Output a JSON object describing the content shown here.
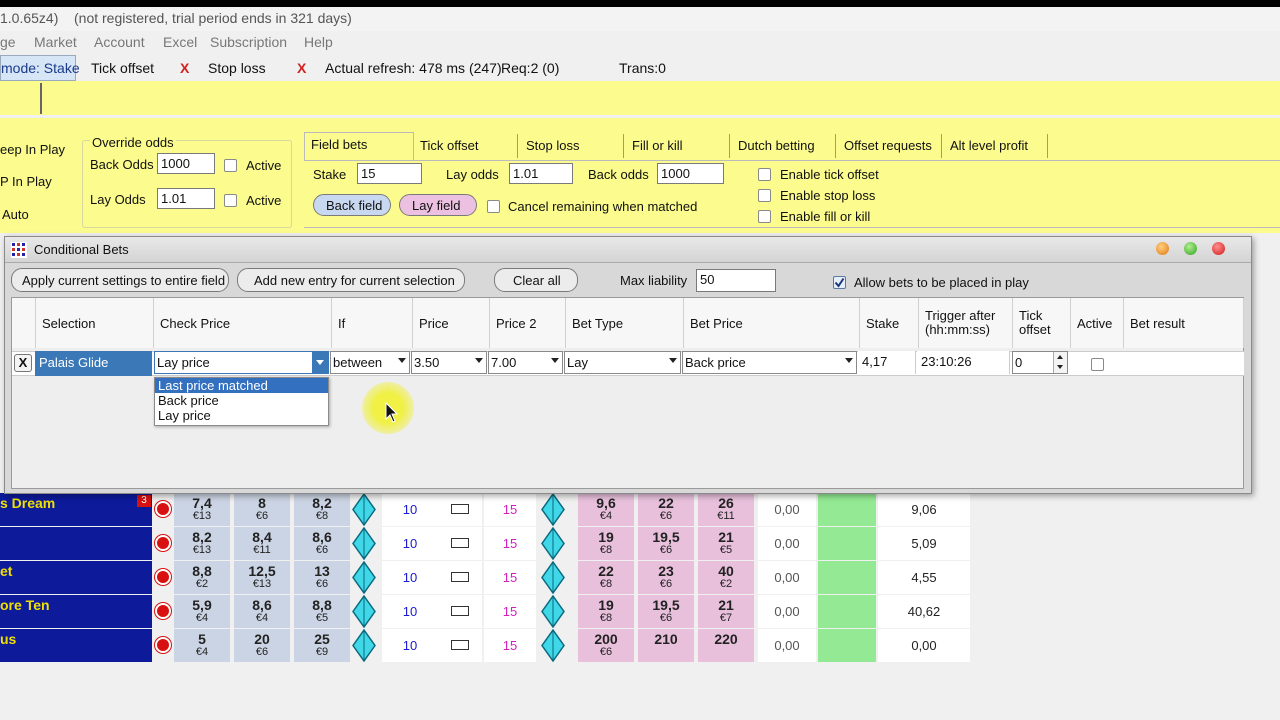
{
  "title_bar": {
    "version": "1.0.65z4)",
    "registration": "(not registered, trial period ends in 321 days)"
  },
  "menu": [
    "ge",
    "Market",
    "Account",
    "Excel",
    "Subscription",
    "Help"
  ],
  "status_bar": {
    "mode": "mode: Stake",
    "tick_offset": "Tick offset",
    "x1": "X",
    "stop_loss": "Stop loss",
    "x2": "X",
    "refresh": "Actual refresh: 478 ms (247)",
    "req": "Req:2 (0)",
    "trans": "Trans:0"
  },
  "left_options": [
    "eep In Play",
    "P In Play",
    "Auto"
  ],
  "override_odds": {
    "title": "Override odds",
    "back_label": "Back Odds",
    "back_value": "1000",
    "lay_label": "Lay Odds",
    "lay_value": "1.01",
    "active_label": "Active"
  },
  "tabs": [
    "Field bets",
    "Tick offset",
    "Stop loss",
    "Fill or kill",
    "Dutch betting",
    "Offset requests",
    "Alt level profit"
  ],
  "field_bets": {
    "stake_label": "Stake",
    "stake_value": "15",
    "lay_odds_label": "Lay odds",
    "lay_odds_value": "1.01",
    "back_odds_label": "Back odds",
    "back_odds_value": "1000",
    "back_field_btn": "Back field",
    "lay_field_btn": "Lay field",
    "cancel_remaining": "Cancel remaining when matched",
    "enable_tick_offset": "Enable tick offset",
    "enable_stop_loss": "Enable stop loss",
    "enable_fill_or_kill": "Enable fill or kill"
  },
  "dialog": {
    "title": "Conditional Bets",
    "apply_btn": "Apply current settings to entire field",
    "add_btn": "Add new entry for current selection",
    "clear_btn": "Clear all",
    "max_liability_label": "Max liability",
    "max_liability_value": "50",
    "allow_inplay_label": "Allow bets to be placed in play",
    "columns": [
      "Selection",
      "Check Price",
      "If",
      "Price",
      "Price 2",
      "Bet Type",
      "Bet Price",
      "Stake",
      "Trigger after (hh:mm:ss)",
      "Tick offset",
      "Active",
      "Bet result"
    ],
    "row": {
      "delete": "X",
      "selection": "Palais Glide",
      "check_price": "Lay price",
      "if": "between",
      "price": "3.50",
      "price2": "7.00",
      "bet_type": "Lay",
      "bet_price": "Back price",
      "stake": "4,17",
      "trigger": "23:10:26",
      "tick_offset": "0"
    },
    "dropdown_options": [
      "Last price matched",
      "Back price",
      "Lay price"
    ]
  },
  "grid_rows": [
    {
      "name": "s Dream",
      "badge": "3",
      "b1": "7,4",
      "b1s": "€13",
      "b2": "8",
      "b2s": "€6",
      "b3": "8,2",
      "b3s": "€8",
      "v1": "10",
      "v2": "15",
      "l1": "9,6",
      "l1s": "€4",
      "l2": "22",
      "l2s": "€6",
      "l3": "26",
      "l3s": "€11",
      "pl": "0,00",
      "val": "9,06"
    },
    {
      "name": "",
      "badge": "",
      "b1": "8,2",
      "b1s": "€13",
      "b2": "8,4",
      "b2s": "€11",
      "b3": "8,6",
      "b3s": "€6",
      "v1": "10",
      "v2": "15",
      "l1": "19",
      "l1s": "€8",
      "l2": "19,5",
      "l2s": "€6",
      "l3": "21",
      "l3s": "€5",
      "pl": "0,00",
      "val": "5,09"
    },
    {
      "name": "et",
      "badge": "",
      "b1": "8,8",
      "b1s": "€2",
      "b2": "12,5",
      "b2s": "€13",
      "b3": "13",
      "b3s": "€6",
      "v1": "10",
      "v2": "15",
      "l1": "22",
      "l1s": "€8",
      "l2": "23",
      "l2s": "€6",
      "l3": "40",
      "l3s": "€2",
      "pl": "0,00",
      "val": "4,55"
    },
    {
      "name": "ore Ten",
      "badge": "",
      "b1": "5,9",
      "b1s": "€4",
      "b2": "8,6",
      "b2s": "€4",
      "b3": "8,8",
      "b3s": "€5",
      "v1": "10",
      "v2": "15",
      "l1": "19",
      "l1s": "€8",
      "l2": "19,5",
      "l2s": "€6",
      "l3": "21",
      "l3s": "€7",
      "pl": "0,00",
      "val": "40,62"
    },
    {
      "name": "us",
      "badge": "",
      "b1": "5",
      "b1s": "€4",
      "b2": "20",
      "b2s": "€6",
      "b3": "25",
      "b3s": "€9",
      "v1": "10",
      "v2": "15",
      "l1": "200",
      "l1s": "€6",
      "l2": "210",
      "l2s": "",
      "l3": "220",
      "l3s": "",
      "pl": "0,00",
      "val": "0,00"
    }
  ]
}
